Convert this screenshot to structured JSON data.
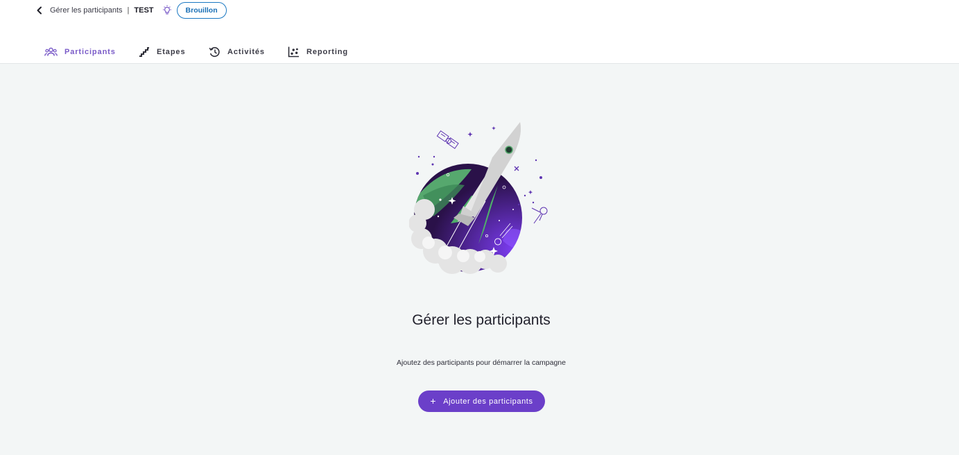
{
  "breadcrumb": {
    "parent": "Gérer les participants",
    "separator": "|",
    "current": "TEST",
    "status": "Brouillon"
  },
  "tabs": [
    {
      "label": "Participants",
      "icon": "people-icon",
      "active": true
    },
    {
      "label": "Etapes",
      "icon": "stairs-icon",
      "active": false
    },
    {
      "label": "Activités",
      "icon": "history-icon",
      "active": false
    },
    {
      "label": "Reporting",
      "icon": "scatter-chart-icon",
      "active": false
    }
  ],
  "empty_state": {
    "illustration": "rocket-launch-illustration",
    "title": "Gérer les participants",
    "subtitle": "Ajoutez des participants pour démarrer la campagne",
    "button_label": "Ajouter des participants"
  },
  "colors": {
    "accent": "#6b3fc9",
    "active_tab": "#7a5bc8",
    "badge_border": "#1a78c2",
    "background": "#f3f6f6"
  }
}
